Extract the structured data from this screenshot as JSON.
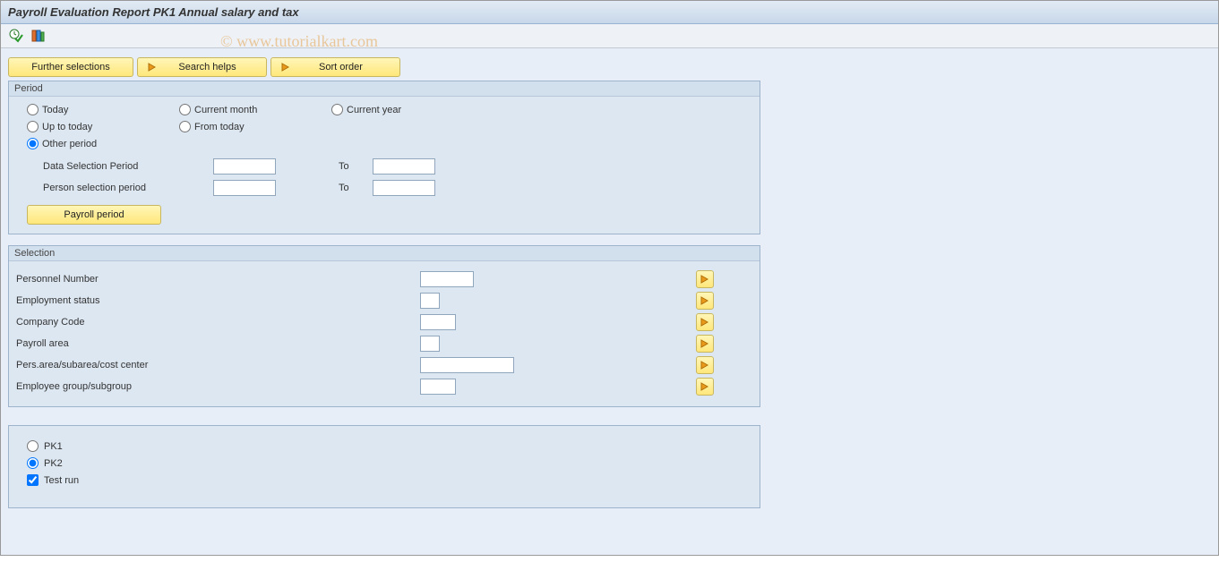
{
  "title": "Payroll Evaluation Report PK1 Annual salary and tax",
  "watermark": "© www.tutorialkart.com",
  "buttons": {
    "further_selections": "Further selections",
    "search_helps": "Search helps",
    "sort_order": "Sort order",
    "payroll_period": "Payroll period"
  },
  "panels": {
    "period": {
      "title": "Period",
      "radios": {
        "today": "Today",
        "current_month": "Current month",
        "current_year": "Current year",
        "up_to_today": "Up to today",
        "from_today": "From today",
        "other_period": "Other period"
      },
      "data_sel_label": "Data Selection Period",
      "person_sel_label": "Person selection period",
      "to_label": "To"
    },
    "selection": {
      "title": "Selection",
      "rows": {
        "pernr": "Personnel Number",
        "emp_status": "Employment status",
        "company_code": "Company Code",
        "payroll_area": "Payroll area",
        "pers_area": "Pers.area/subarea/cost center",
        "emp_group": "Employee group/subgroup"
      }
    },
    "options": {
      "pk1": "PK1",
      "pk2": "PK2",
      "test_run": "Test run"
    }
  }
}
